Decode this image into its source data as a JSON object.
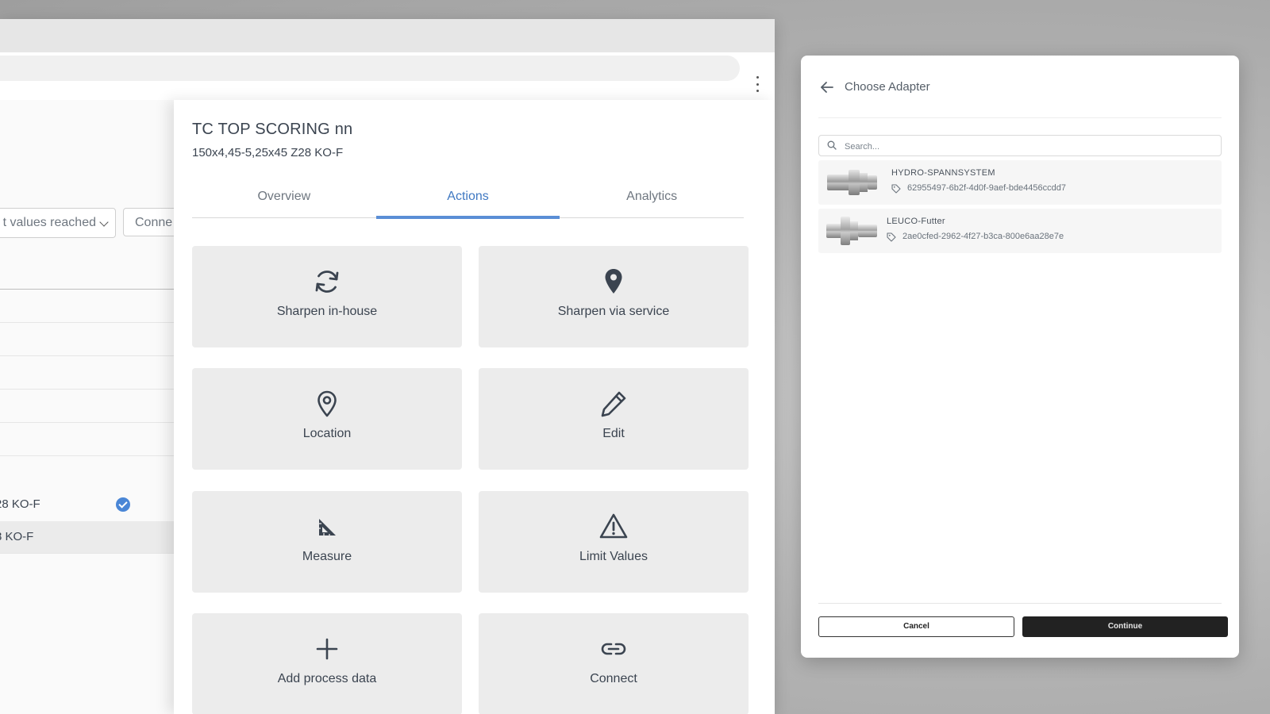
{
  "background_app": {
    "filter_label": "t values reached",
    "connect_label": "Conne",
    "rows": [
      {
        "label": "28 KO-F",
        "checked": true
      },
      {
        "label": "8 KO-F",
        "selected": true
      }
    ]
  },
  "panel": {
    "title": "TC TOP SCORING nn",
    "subtitle": "150x4,45-5,25x45 Z28 KO-F",
    "tabs": [
      {
        "label": "Overview"
      },
      {
        "label": "Actions",
        "active": true
      },
      {
        "label": "Analytics"
      }
    ],
    "actions": [
      {
        "label": "Sharpen in-house",
        "icon": "refresh-icon"
      },
      {
        "label": "Sharpen via service",
        "icon": "map-pin-filled-icon"
      },
      {
        "label": "Location",
        "icon": "map-pin-outline-icon"
      },
      {
        "label": "Edit",
        "icon": "pencil-icon"
      },
      {
        "label": "Measure",
        "icon": "set-square-icon"
      },
      {
        "label": "Limit Values",
        "icon": "warning-triangle-icon"
      },
      {
        "label": "Add process data",
        "icon": "plus-icon"
      },
      {
        "label": "Connect",
        "icon": "link-icon"
      }
    ],
    "accent_color": "#5a8ed6"
  },
  "dialog": {
    "title": "Choose Adapter",
    "search_placeholder": "Search...",
    "adapters": [
      {
        "name": "HYDRO-SPANNSYSTEM",
        "id": "62955497-6b2f-4d0f-9aef-bde4456ccdd7"
      },
      {
        "name": "LEUCO-Futter",
        "id": "2ae0cfed-2962-4f27-b3ca-800e6aa28e7e"
      }
    ],
    "cancel_label": "Cancel",
    "continue_label": "Continue"
  }
}
